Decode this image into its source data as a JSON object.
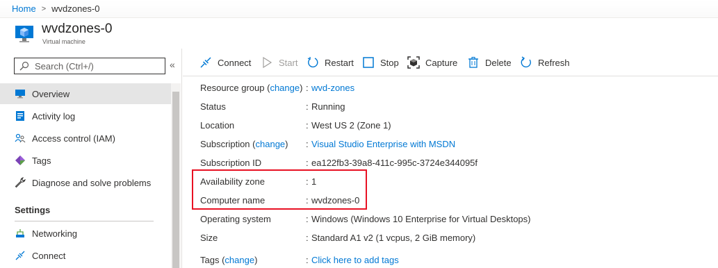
{
  "breadcrumb": {
    "home": "Home",
    "separator": ">",
    "current": "wvdzones-0"
  },
  "header": {
    "title": "wvdzones-0",
    "subtitle": "Virtual machine"
  },
  "search": {
    "placeholder": "Search (Ctrl+/)"
  },
  "sidebar": {
    "collapse": "«",
    "items": [
      {
        "label": "Overview",
        "icon": "monitor-icon",
        "active": true
      },
      {
        "label": "Activity log",
        "icon": "activity-log-icon"
      },
      {
        "label": "Access control (IAM)",
        "icon": "people-icon"
      },
      {
        "label": "Tags",
        "icon": "tag-icon"
      },
      {
        "label": "Diagnose and solve problems",
        "icon": "wrench-icon"
      }
    ],
    "section": "Settings",
    "settings_items": [
      {
        "label": "Networking",
        "icon": "network-icon"
      },
      {
        "label": "Connect",
        "icon": "connect-icon"
      }
    ]
  },
  "toolbar": {
    "connect": "Connect",
    "start": "Start",
    "restart": "Restart",
    "stop": "Stop",
    "capture": "Capture",
    "delete": "Delete",
    "refresh": "Refresh"
  },
  "properties": {
    "resource_group": {
      "key": "Resource group",
      "change": "change",
      "value": "wvd-zones"
    },
    "status": {
      "key": "Status",
      "value": "Running"
    },
    "location": {
      "key": "Location",
      "value": "West US 2 (Zone 1)"
    },
    "subscription": {
      "key": "Subscription",
      "change": "change",
      "value": "Visual Studio Enterprise with MSDN"
    },
    "subscription_id": {
      "key": "Subscription ID",
      "value": "ea122fb3-39a8-411c-995c-3724e344095f"
    },
    "availability_zone": {
      "key": "Availability zone",
      "value": "1"
    },
    "computer_name": {
      "key": "Computer name",
      "value": "wvdzones-0"
    },
    "operating_system": {
      "key": "Operating system",
      "value": "Windows (Windows 10 Enterprise for Virtual Desktops)"
    },
    "size": {
      "key": "Size",
      "value": "Standard A1 v2 (1 vcpus, 2 GiB memory)"
    },
    "tags": {
      "key": "Tags",
      "change": "change",
      "value": "Click here to add tags"
    }
  },
  "colors": {
    "link": "#0078d4",
    "highlight": "#e81123",
    "active_nav": "#e5e5e5"
  }
}
